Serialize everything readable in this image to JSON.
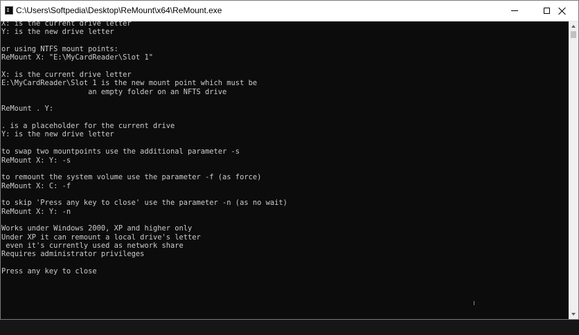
{
  "window": {
    "title": "C:\\Users\\Softpedia\\Desktop\\ReMount\\x64\\ReMount.exe",
    "icon": "console-app-icon",
    "controls": [
      "minimize",
      "maximize",
      "close"
    ]
  },
  "console": {
    "lines": [
      "X: is the current drive letter",
      "Y: is the new drive letter",
      "",
      "or using NTFS mount points:",
      "ReMount X: \"E:\\MyCardReader\\Slot 1\"",
      "",
      "X: is the current drive letter",
      "E:\\MyCardReader\\Slot 1 is the new mount point which must be",
      "                    an empty folder on an NFTS drive",
      "",
      "ReMount . Y:",
      "",
      ". is a placeholder for the current drive",
      "Y: is the new drive letter",
      "",
      "to swap two mountpoints use the additional parameter -s",
      "ReMount X: Y: -s",
      "",
      "to remount the system volume use the parameter -f (as force)",
      "ReMount X: C: -f",
      "",
      "to skip 'Press any key to close' use the parameter -n (as no wait)",
      "ReMount X: Y: -n",
      "",
      "Works under Windows 2000, XP and higher only",
      "Under XP it can remount a local drive's letter",
      " even it's currently used as network share",
      "Requires administrator privileges",
      "",
      "Press any key to close"
    ]
  },
  "colors": {
    "console_bg": "#0c0c0c",
    "console_fg": "#cccccc",
    "titlebar_bg": "#ffffff"
  }
}
